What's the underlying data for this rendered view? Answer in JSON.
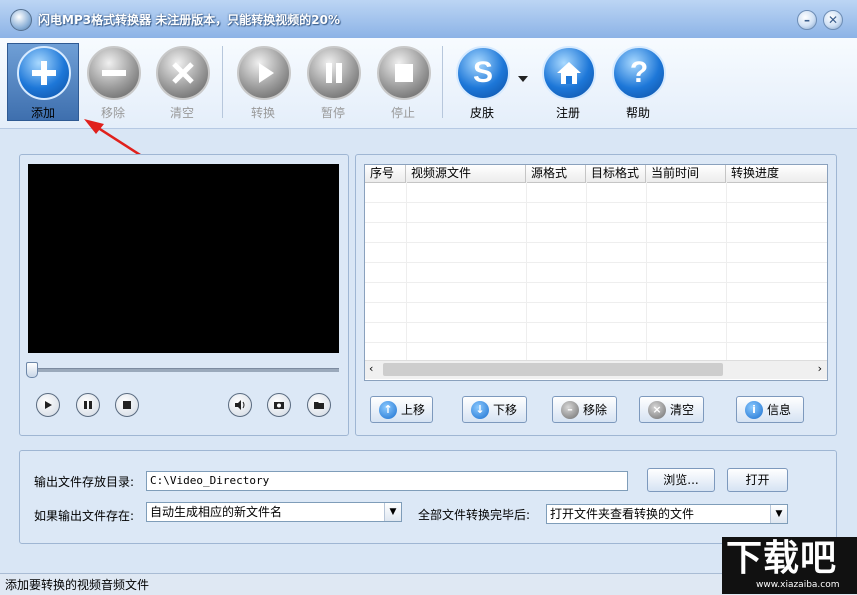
{
  "window": {
    "title": "闪电MP3格式转换器   未注册版本，只能转换视频的20%",
    "minimize_glyph": "–",
    "close_glyph": "✕"
  },
  "toolbar": {
    "add": "添加",
    "remove": "移除",
    "clear": "清空",
    "convert": "转换",
    "pause": "暂停",
    "stop": "停止",
    "skin": "皮肤",
    "register": "注册",
    "help": "帮助"
  },
  "file_list": {
    "columns": [
      "序号",
      "视频源文件",
      "源格式",
      "目标格式",
      "当前时间",
      "转换进度"
    ],
    "rows": []
  },
  "list_buttons": {
    "move_up": "上移",
    "move_down": "下移",
    "remove": "移除",
    "clear": "清空",
    "info": "信息"
  },
  "output": {
    "dir_label": "输出文件存放目录:",
    "dir_value": "C:\\Video_Directory",
    "browse": "浏览...",
    "open": "打开",
    "exists_label": "如果输出文件存在:",
    "exists_value": "自动生成相应的新文件名",
    "after_label": "全部文件转换完毕后:",
    "after_value": "打开文件夹查看转换的文件"
  },
  "status": {
    "text": "添加要转换的视频音频文件"
  },
  "watermark": {
    "big": "下载吧",
    "small": "www.xiazaiba.com"
  },
  "colors": {
    "accent": "#1d77d8",
    "selected": "#3e6fae",
    "arrow": "#e0201c"
  }
}
